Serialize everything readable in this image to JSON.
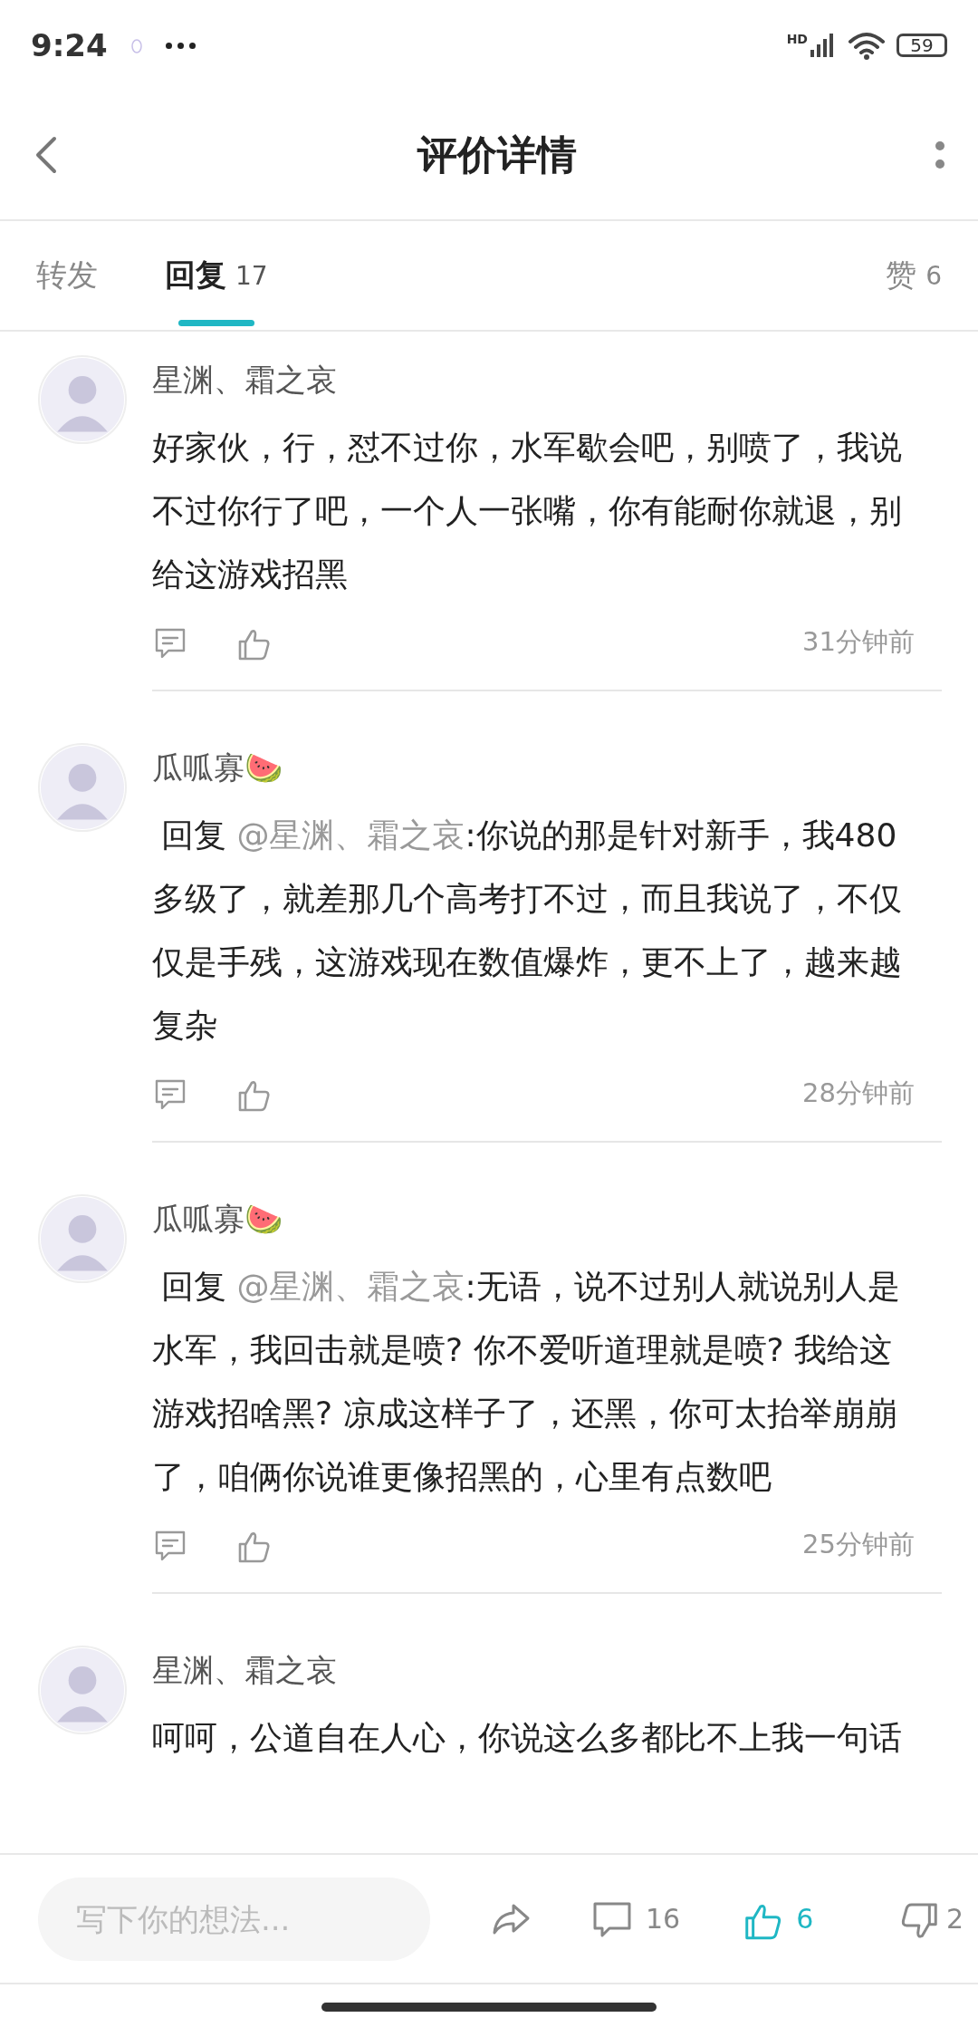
{
  "status_bar": {
    "time": "9:24",
    "network": "HD",
    "battery": "59"
  },
  "header": {
    "title": "评价详情"
  },
  "tabs": [
    {
      "label": "转发",
      "selected": false
    },
    {
      "label": "回复",
      "count": "17",
      "selected": true
    },
    {
      "label": "赞",
      "count": "6",
      "selected": false
    }
  ],
  "comments": [
    {
      "author": "星渊、霜之哀",
      "text": "好家伙，行，怼不过你，水军歇会吧，别喷了，我说不过你行了吧，一个人一张嘴，你有能耐你就退，别给这游戏招黑",
      "time": "31分钟前"
    },
    {
      "author": "瓜呱寡🍉",
      "reply_label": "回复",
      "mention": "@星渊、霜之哀",
      "text": ":你说的那是针对新手，我480多级了，就差那几个高考打不过，而且我说了，不仅仅是手残，这游戏现在数值爆炸，更不上了，越来越复杂",
      "time": "28分钟前"
    },
    {
      "author": "瓜呱寡🍉",
      "reply_label": "回复",
      "mention": "@星渊、霜之哀",
      "text": ":无语，说不过别人就说别人是水军，我回击就是喷? 你不爱听道理就是喷? 我给这游戏招啥黑? 凉成这样子了，还黑，你可太抬举崩崩了，咱俩你说谁更像招黑的，心里有点数吧",
      "time": "25分钟前"
    },
    {
      "author": "星渊、霜之哀",
      "text": "呵呵，公道自在人心，你说这么多都比不上我一句话"
    }
  ],
  "bottom_bar": {
    "placeholder": "写下你的想法...",
    "comments": "16",
    "likes": "6",
    "liked": true,
    "dislikes": "2"
  }
}
